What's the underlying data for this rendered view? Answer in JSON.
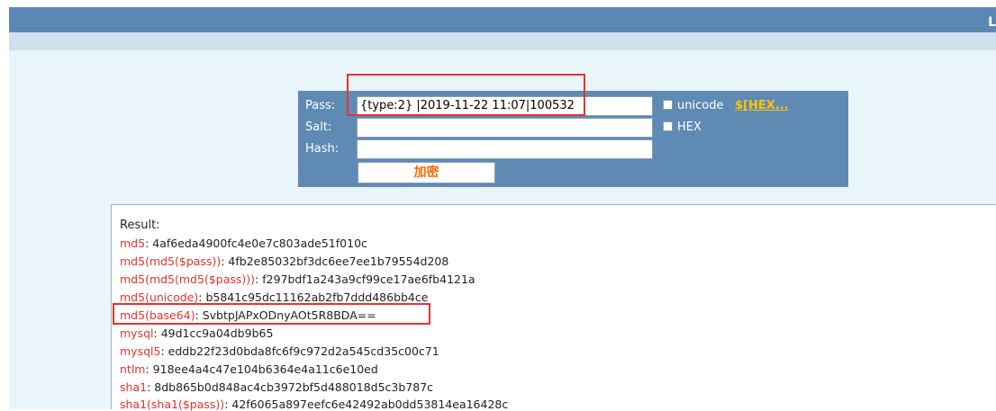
{
  "header": {
    "right_glyph": "L"
  },
  "form": {
    "pass_label": "Pass:",
    "pass_value": "{type:2}  |2019-11-22 11:07|100532",
    "salt_label": "Salt:",
    "salt_value": "",
    "hash_label": "Hash:",
    "hash_value": "",
    "unicode_label": "unicode",
    "hex_link": "$[HEX...",
    "hex_label": "HEX",
    "encrypt_button": "加密"
  },
  "result": {
    "title": "Result:",
    "rows": [
      {
        "key": "md5",
        "value": "4af6eda4900fc4e0e7c803ade51f010c"
      },
      {
        "key": "md5(md5($pass))",
        "value": "4fb2e85032bf3dc6ee7ee1b79554d208"
      },
      {
        "key": "md5(md5(md5($pass)))",
        "value": "f297bdf1a243a9cf99ce17ae6fb4121a"
      },
      {
        "key": "md5(unicode)",
        "value": "b5841c95dc11162ab2fb7ddd486bb4ce"
      },
      {
        "key": "md5(base64)",
        "value": "SvbtpJAPxODnyAOt5R8BDA=="
      },
      {
        "key": "mysql",
        "value": "49d1cc9a04db9b65"
      },
      {
        "key": "mysql5",
        "value": "eddb22f23d0bda8fc6f9c972d2a545cd35c00c71"
      },
      {
        "key": "ntlm",
        "value": "918ee4a4c47e104b6364e4a11c6e10ed"
      },
      {
        "key": "sha1",
        "value": "8db865b0d848ac4cb3972bf5d488018d5c3b787c"
      },
      {
        "key": "sha1(sha1($pass))",
        "value": "42f6065a897eefc6e42492ab0dd53814ea16428c"
      }
    ]
  },
  "colors": {
    "accent": "#5f8ab4",
    "key_red": "#e8322d",
    "button_text": "#ff6600"
  }
}
